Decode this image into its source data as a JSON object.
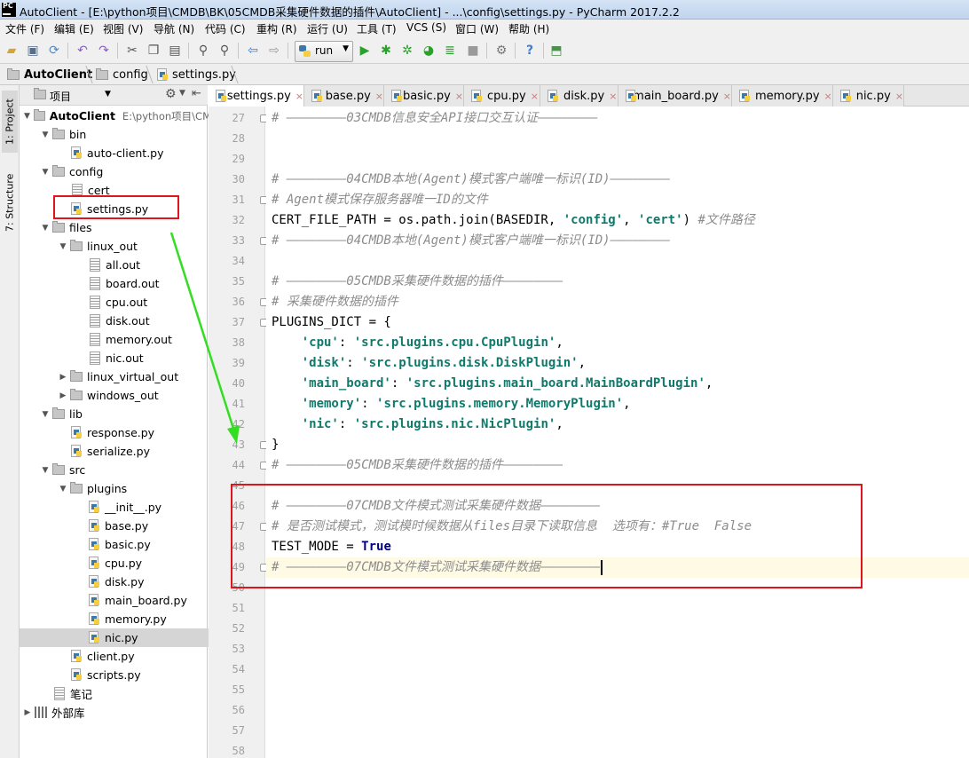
{
  "window": {
    "title": "AutoClient - [E:\\python项目\\CMDB\\BK\\05CMDB采集硬件数据的插件\\AutoClient] - ...\\config\\settings.py - PyCharm 2017.2.2",
    "logo_text": "PC"
  },
  "menu": [
    "文件 (F)",
    "编辑 (E)",
    "视图 (V)",
    "导航 (N)",
    "代码 (C)",
    "重构 (R)",
    "运行 (U)",
    "工具 (T)",
    "VCS (S)",
    "窗口 (W)",
    "帮助 (H)"
  ],
  "toolbar": {
    "run_config": "run"
  },
  "breadcrumb": [
    "AutoClient",
    "config",
    "settings.py"
  ],
  "sidebar_tabs": [
    "1: Project",
    "7: Structure"
  ],
  "project_panel": {
    "title": "项目",
    "root_name": "AutoClient",
    "root_path": "E:\\python项目\\CM",
    "tree": [
      {
        "label": "bin",
        "kind": "folder",
        "depth": 1,
        "open": true
      },
      {
        "label": "auto-client.py",
        "kind": "py",
        "depth": 2
      },
      {
        "label": "config",
        "kind": "folder",
        "depth": 1,
        "open": true
      },
      {
        "label": "cert",
        "kind": "txt",
        "depth": 2
      },
      {
        "label": "settings.py",
        "kind": "py",
        "depth": 2
      },
      {
        "label": "files",
        "kind": "folder",
        "depth": 1,
        "open": true
      },
      {
        "label": "linux_out",
        "kind": "folder",
        "depth": 2,
        "open": true
      },
      {
        "label": "all.out",
        "kind": "txt",
        "depth": 3
      },
      {
        "label": "board.out",
        "kind": "txt",
        "depth": 3
      },
      {
        "label": "cpu.out",
        "kind": "txt",
        "depth": 3
      },
      {
        "label": "disk.out",
        "kind": "txt",
        "depth": 3
      },
      {
        "label": "memory.out",
        "kind": "txt",
        "depth": 3
      },
      {
        "label": "nic.out",
        "kind": "txt",
        "depth": 3
      },
      {
        "label": "linux_virtual_out",
        "kind": "folder",
        "depth": 2,
        "open": false
      },
      {
        "label": "windows_out",
        "kind": "folder",
        "depth": 2,
        "open": false
      },
      {
        "label": "lib",
        "kind": "folder",
        "depth": 1,
        "open": true
      },
      {
        "label": "response.py",
        "kind": "py",
        "depth": 2
      },
      {
        "label": "serialize.py",
        "kind": "py",
        "depth": 2
      },
      {
        "label": "src",
        "kind": "folder",
        "depth": 1,
        "open": true
      },
      {
        "label": "plugins",
        "kind": "folder",
        "depth": 2,
        "open": true
      },
      {
        "label": "__init__.py",
        "kind": "py",
        "depth": 3
      },
      {
        "label": "base.py",
        "kind": "py",
        "depth": 3
      },
      {
        "label": "basic.py",
        "kind": "py",
        "depth": 3
      },
      {
        "label": "cpu.py",
        "kind": "py",
        "depth": 3
      },
      {
        "label": "disk.py",
        "kind": "py",
        "depth": 3
      },
      {
        "label": "main_board.py",
        "kind": "py",
        "depth": 3
      },
      {
        "label": "memory.py",
        "kind": "py",
        "depth": 3
      },
      {
        "label": "nic.py",
        "kind": "py",
        "depth": 3,
        "selected": true
      },
      {
        "label": "client.py",
        "kind": "py",
        "depth": 2
      },
      {
        "label": "scripts.py",
        "kind": "py",
        "depth": 2
      },
      {
        "label": "笔记",
        "kind": "txt",
        "depth": 1
      },
      {
        "label": "外部库",
        "kind": "lib",
        "depth": 0,
        "open": false
      }
    ]
  },
  "editor": {
    "tabs": [
      "settings.py",
      "base.py",
      "basic.py",
      "cpu.py",
      "disk.py",
      "main_board.py",
      "memory.py",
      "nic.py"
    ],
    "active_tab": 0,
    "lines": [
      {
        "n": "27",
        "parts": [
          [
            "cm",
            "# ————————03CMDB信息安全API接口交互认证————————"
          ]
        ]
      },
      {
        "n": "28",
        "parts": []
      },
      {
        "n": "29",
        "parts": []
      },
      {
        "n": "30",
        "parts": [
          [
            "cm",
            "# ————————04CMDB本地(Agent)模式客户端唯一标识(ID)————————"
          ]
        ]
      },
      {
        "n": "31",
        "parts": [
          [
            "cm",
            "# Agent模式保存服务器唯一ID的文件"
          ]
        ]
      },
      {
        "n": "32",
        "parts": [
          [
            "",
            "CERT_FILE_PATH = os.path.join(BASEDIR, "
          ],
          [
            "st",
            "'config'"
          ],
          [
            "",
            ", "
          ],
          [
            "st",
            "'cert'"
          ],
          [
            "",
            ") "
          ],
          [
            "cm",
            "#文件路径"
          ]
        ]
      },
      {
        "n": "33",
        "parts": [
          [
            "cm",
            "# ————————04CMDB本地(Agent)模式客户端唯一标识(ID)————————"
          ]
        ]
      },
      {
        "n": "34",
        "parts": []
      },
      {
        "n": "35",
        "parts": [
          [
            "cm",
            "# ————————05CMDB采集硬件数据的插件————————"
          ]
        ]
      },
      {
        "n": "36",
        "parts": [
          [
            "cm",
            "# 采集硬件数据的插件"
          ]
        ]
      },
      {
        "n": "37",
        "parts": [
          [
            "",
            "PLUGINS_DICT = {"
          ]
        ]
      },
      {
        "n": "38",
        "parts": [
          [
            "",
            "    "
          ],
          [
            "st",
            "'cpu'"
          ],
          [
            "",
            ": "
          ],
          [
            "st",
            "'src.plugins.cpu.CpuPlugin'"
          ],
          [
            "",
            ","
          ]
        ]
      },
      {
        "n": "39",
        "parts": [
          [
            "",
            "    "
          ],
          [
            "st",
            "'disk'"
          ],
          [
            "",
            ": "
          ],
          [
            "st",
            "'src.plugins.disk.DiskPlugin'"
          ],
          [
            "",
            ","
          ]
        ]
      },
      {
        "n": "40",
        "parts": [
          [
            "",
            "    "
          ],
          [
            "st",
            "'main_board'"
          ],
          [
            "",
            ": "
          ],
          [
            "st",
            "'src.plugins.main_board.MainBoardPlugin'"
          ],
          [
            "",
            ","
          ]
        ]
      },
      {
        "n": "41",
        "parts": [
          [
            "",
            "    "
          ],
          [
            "st",
            "'memory'"
          ],
          [
            "",
            ": "
          ],
          [
            "st",
            "'src.plugins.memory.MemoryPlugin'"
          ],
          [
            "",
            ","
          ]
        ]
      },
      {
        "n": "42",
        "parts": [
          [
            "",
            "    "
          ],
          [
            "st",
            "'nic'"
          ],
          [
            "",
            ": "
          ],
          [
            "st",
            "'src.plugins.nic.NicPlugin'"
          ],
          [
            "",
            ","
          ]
        ]
      },
      {
        "n": "43",
        "parts": [
          [
            "",
            "}"
          ]
        ]
      },
      {
        "n": "44",
        "parts": [
          [
            "cm",
            "# ————————05CMDB采集硬件数据的插件————————"
          ]
        ]
      },
      {
        "n": "45",
        "parts": []
      },
      {
        "n": "46",
        "parts": [
          [
            "cm",
            "# ————————07CMDB文件模式测试采集硬件数据————————"
          ]
        ]
      },
      {
        "n": "47",
        "parts": [
          [
            "cm",
            "# 是否测试模式，测试模时候数据从files目录下读取信息  选项有：#True  False"
          ]
        ]
      },
      {
        "n": "48",
        "parts": [
          [
            "",
            "TEST_MODE = "
          ],
          [
            "kw",
            "True"
          ]
        ]
      },
      {
        "n": "49",
        "parts": [
          [
            "cm",
            "# ————————07CMDB文件模式测试采集硬件数据————————"
          ]
        ],
        "current": true
      },
      {
        "n": "50",
        "parts": []
      },
      {
        "n": "51",
        "parts": []
      },
      {
        "n": "52",
        "parts": []
      },
      {
        "n": "53",
        "parts": []
      },
      {
        "n": "54",
        "parts": []
      },
      {
        "n": "55",
        "parts": []
      },
      {
        "n": "56",
        "parts": []
      },
      {
        "n": "57",
        "parts": []
      },
      {
        "n": "58",
        "parts": []
      }
    ]
  },
  "annotation_colors": {
    "box": "#e0141b",
    "arrow": "#33dd22"
  }
}
